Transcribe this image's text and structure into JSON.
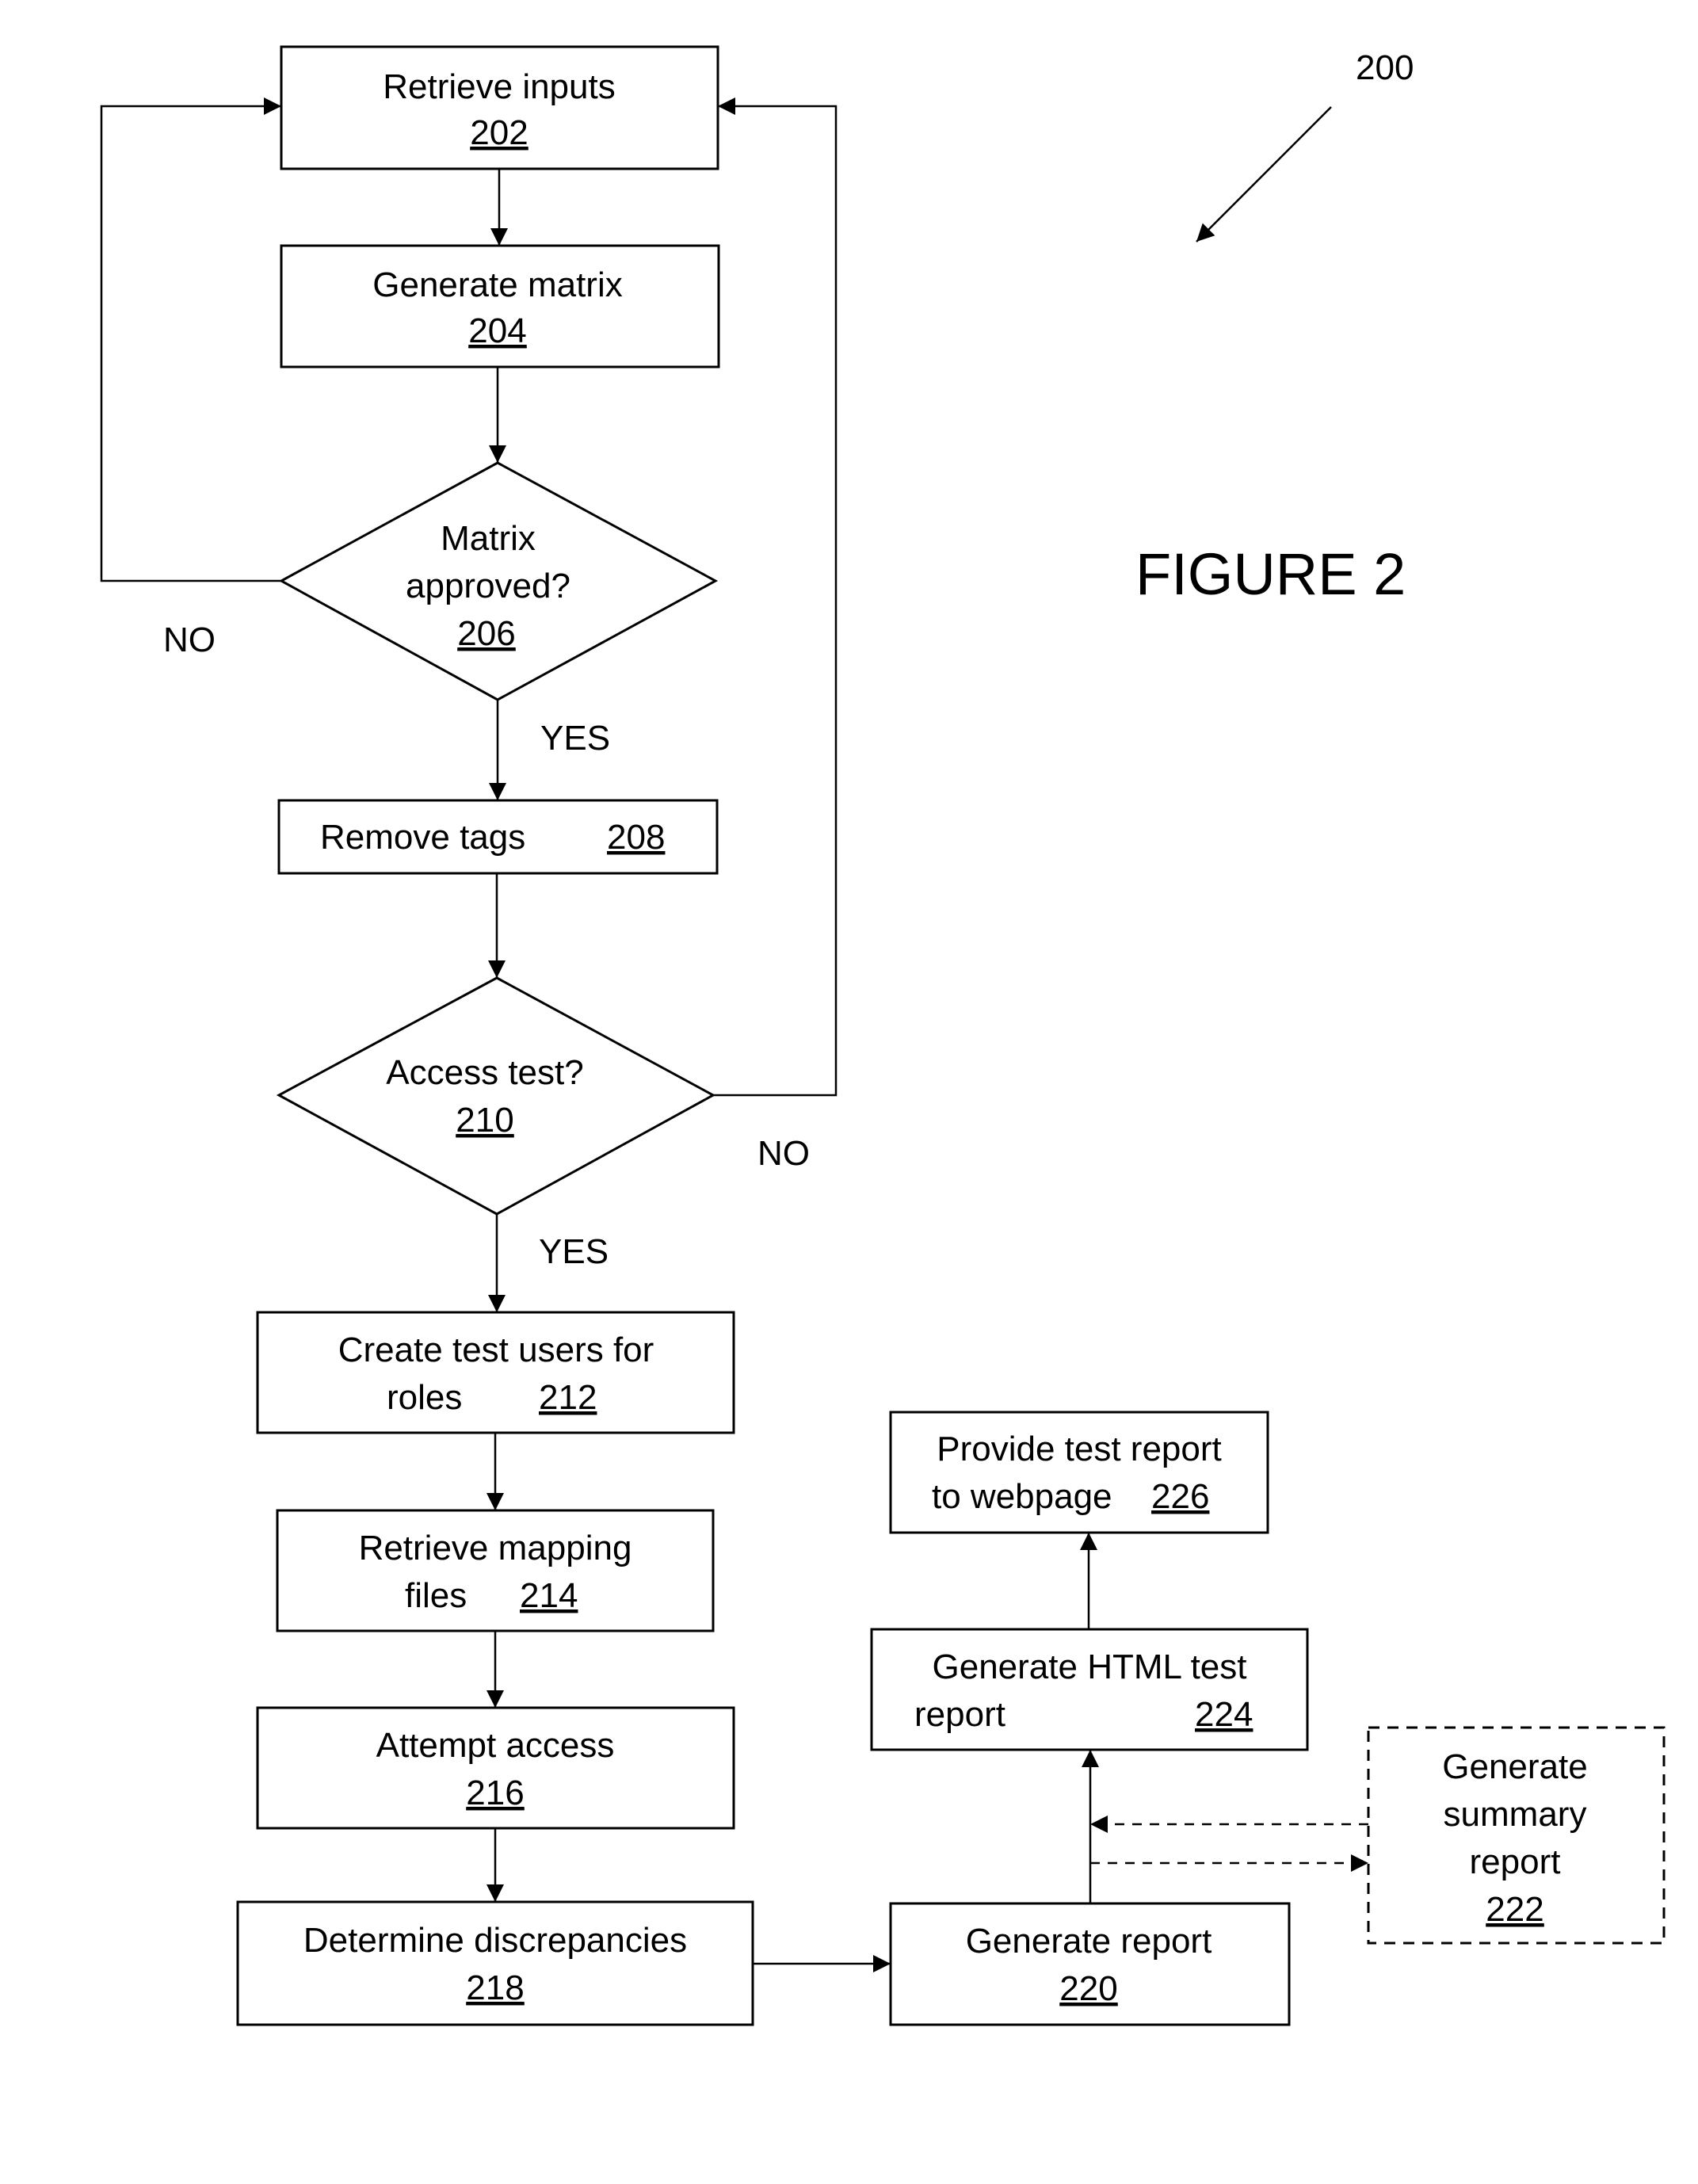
{
  "figure": {
    "title": "FIGURE 2",
    "reference": "200"
  },
  "nodes": {
    "n202": {
      "lines": [
        "Retrieve inputs"
      ],
      "ref": "202",
      "shape": "process"
    },
    "n204": {
      "lines": [
        "Generate matrix"
      ],
      "ref": "204",
      "shape": "process"
    },
    "n206": {
      "lines": [
        "Matrix",
        "approved?"
      ],
      "ref": "206",
      "shape": "decision"
    },
    "n208": {
      "lines": [
        "Remove tags"
      ],
      "ref": "208",
      "shape": "process"
    },
    "n210": {
      "lines": [
        "Access test?"
      ],
      "ref": "210",
      "shape": "decision"
    },
    "n212": {
      "lines": [
        "Create test users for",
        "roles"
      ],
      "ref": "212",
      "shape": "process"
    },
    "n214": {
      "lines": [
        "Retrieve mapping",
        "files"
      ],
      "ref": "214",
      "shape": "process"
    },
    "n216": {
      "lines": [
        "Attempt access"
      ],
      "ref": "216",
      "shape": "process"
    },
    "n218": {
      "lines": [
        "Determine discrepancies"
      ],
      "ref": "218",
      "shape": "process"
    },
    "n220": {
      "lines": [
        "Generate report"
      ],
      "ref": "220",
      "shape": "process"
    },
    "n222": {
      "lines": [
        "Generate",
        "summary",
        "report"
      ],
      "ref": "222",
      "shape": "optional-process"
    },
    "n224": {
      "lines": [
        "Generate HTML test",
        "report"
      ],
      "ref": "224",
      "shape": "process"
    },
    "n226": {
      "lines": [
        "Provide test report",
        "to webpage"
      ],
      "ref": "226",
      "shape": "process"
    }
  },
  "edge_labels": {
    "n206_no": "NO",
    "n206_yes": "YES",
    "n210_no": "NO",
    "n210_yes": "YES"
  },
  "edges": [
    {
      "from": "202",
      "to": "204",
      "style": "solid"
    },
    {
      "from": "204",
      "to": "206",
      "style": "solid"
    },
    {
      "from": "206",
      "to": "202",
      "label": "NO",
      "style": "solid"
    },
    {
      "from": "206",
      "to": "208",
      "label": "YES",
      "style": "solid"
    },
    {
      "from": "208",
      "to": "210",
      "style": "solid"
    },
    {
      "from": "210",
      "to": "202",
      "label": "NO",
      "style": "solid"
    },
    {
      "from": "210",
      "to": "212",
      "label": "YES",
      "style": "solid"
    },
    {
      "from": "212",
      "to": "214",
      "style": "solid"
    },
    {
      "from": "214",
      "to": "216",
      "style": "solid"
    },
    {
      "from": "216",
      "to": "218",
      "style": "solid"
    },
    {
      "from": "218",
      "to": "220",
      "style": "solid"
    },
    {
      "from": "220",
      "to": "224",
      "style": "solid"
    },
    {
      "from": "220",
      "to": "222",
      "style": "dashed"
    },
    {
      "from": "222",
      "to": "224",
      "style": "dashed"
    },
    {
      "from": "224",
      "to": "226",
      "style": "solid"
    }
  ]
}
